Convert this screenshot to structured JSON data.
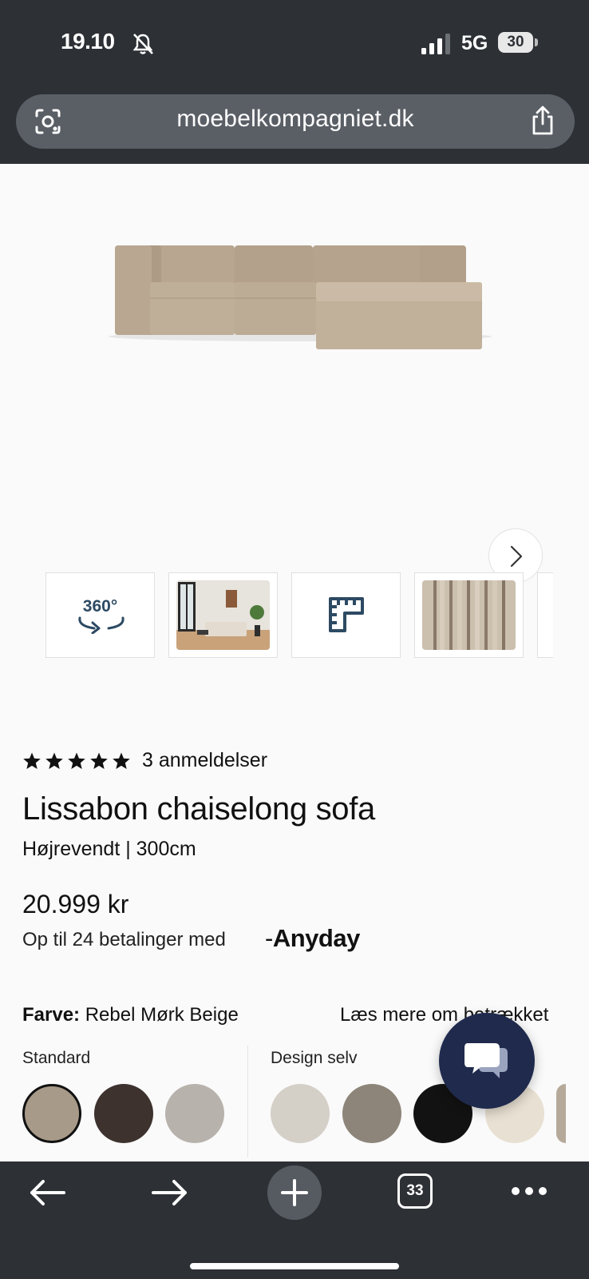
{
  "status_bar": {
    "time": "19.10",
    "network": "5G",
    "battery": "30"
  },
  "browser": {
    "url": "moebelkompagniet.dk",
    "open_tabs": "33"
  },
  "gallery": {
    "thumbnails": [
      {
        "label": "360°",
        "icon": "rotate-360-icon"
      },
      {
        "label": "",
        "icon": "room-photo"
      },
      {
        "label": "",
        "icon": "ruler-icon"
      },
      {
        "label": "",
        "icon": "fabric-photo"
      }
    ]
  },
  "product": {
    "rating": 5,
    "reviews": "3 anmeldelser",
    "title": "Lissabon chaiselong sofa",
    "variant": "Højrevendt | 300cm",
    "price": "20.999 kr",
    "installments_text": "Op til 24 betalinger med",
    "payment_brand": "Anyday",
    "color_label": "Farve:",
    "color_value": "Rebel Mørk Beige",
    "read_more": "Læs mere om betrækket",
    "group_standard": "Standard",
    "group_design": "Design selv"
  },
  "swatches": {
    "standard": [
      "#a89a88",
      "#3d322e",
      "#b8b2ac"
    ],
    "design": [
      "#d4cfc7",
      "#8e857a",
      "#121212",
      "#e8e0d2",
      "#b5a99a"
    ]
  },
  "colors": {
    "chrome": "#2d3136",
    "chat": "#1f2a4d"
  }
}
